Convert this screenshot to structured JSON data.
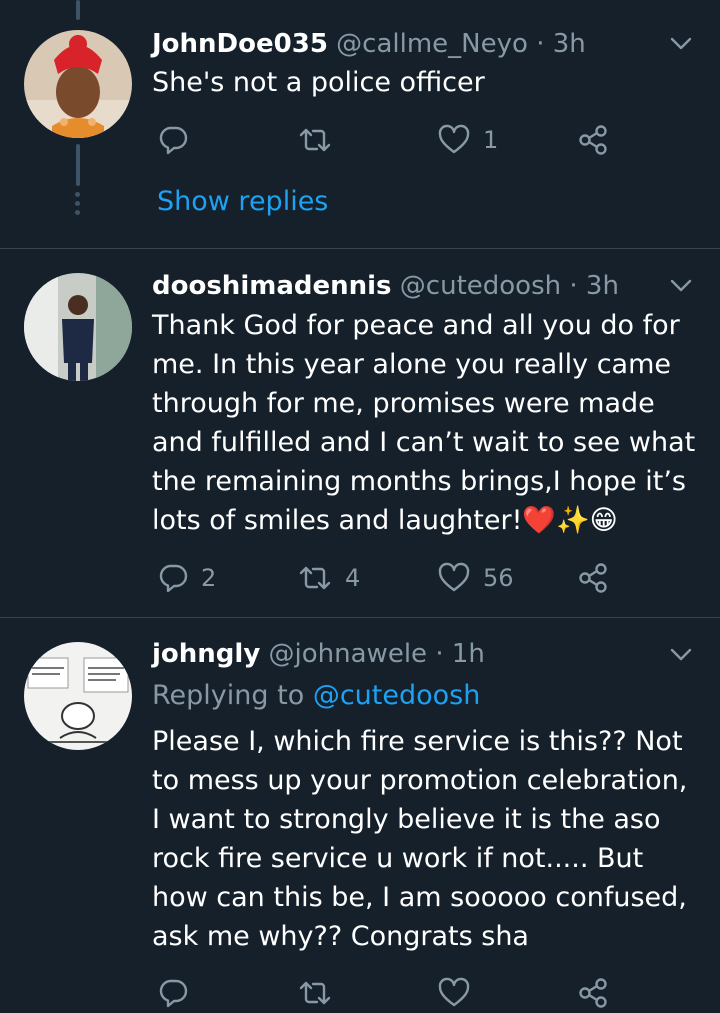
{
  "tweets": [
    {
      "name": "JohnDoe035",
      "handle": "@callme_Neyo",
      "separator": "·",
      "time": "3h",
      "text": "She's not a police officer",
      "replies": "",
      "retweets": "",
      "likes": "1",
      "show_replies": "Show replies"
    },
    {
      "name": "dooshimadennis",
      "handle": "@cutedoosh",
      "separator": "·",
      "time": "3h",
      "text": "Thank God for peace and all you do for me. In this year alone you really came through for me, promises were made and fulfilled and I can’t wait to see what the remaining months brings,I hope it’s lots of smiles and laughter!❤️✨😁",
      "replies": "2",
      "retweets": "4",
      "likes": "56"
    },
    {
      "name": "johngly",
      "handle": "@johnawele",
      "separator": "·",
      "time": "1h",
      "replying_label": "Replying to",
      "replying_to": "@cutedoosh",
      "text": "Please I, which fire service is this?? Not to mess up your promotion celebration, I want to strongly believe it is the aso rock fire service u work if not..... But how can this be, I am sooooo confused, ask me why?? Congrats sha",
      "replies": "",
      "retweets": "",
      "likes": ""
    }
  ],
  "colors": {
    "background": "#15202b",
    "text": "#ffffff",
    "muted": "#8899a6",
    "accent": "#1da1f2",
    "divider": "#38444d",
    "thread": "#3d5466"
  },
  "icons": {
    "reply": "reply-icon",
    "retweet": "retweet-icon",
    "like": "heart-icon",
    "share": "share-icon",
    "more": "chevron-down-icon"
  }
}
